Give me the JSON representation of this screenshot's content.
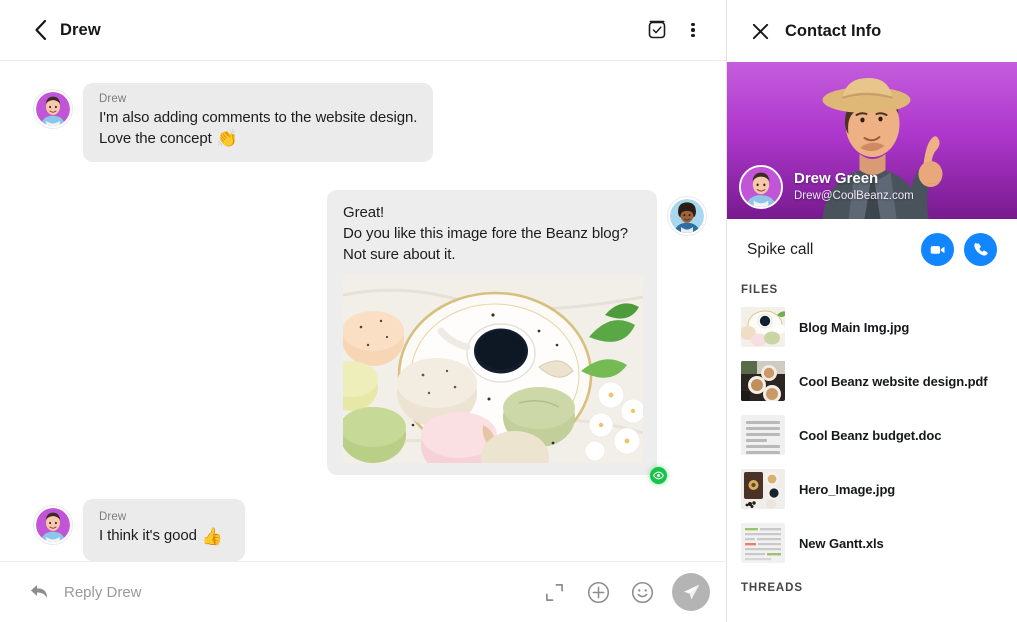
{
  "chat": {
    "header": {
      "title": "Drew",
      "back_icon": "back-chevron-icon",
      "task_icon": "checkbox-task-icon",
      "menu_icon": "more-vertical-icon"
    },
    "messages": [
      {
        "direction": "incoming",
        "sender": "Drew",
        "lines": [
          "I'm also adding comments to the website design.",
          "Love the concept"
        ],
        "emoji": "👏",
        "avatar_name": "drew-avatar"
      },
      {
        "direction": "outgoing",
        "sender": "",
        "lines": [
          "Great!",
          "Do you like this image fore the Beanz blog?",
          "Not sure about it."
        ],
        "emoji": "",
        "attachment": "coffee-macarons-photo",
        "status": "seen",
        "avatar_name": "me-avatar"
      },
      {
        "direction": "incoming",
        "sender": "Drew",
        "lines": [
          "I think it's good"
        ],
        "emoji": "👍",
        "avatar_name": "drew-avatar"
      }
    ],
    "composer": {
      "reply_icon": "reply-arrow-icon",
      "placeholder": "Reply Drew",
      "value": "",
      "expand_icon": "expand-icon",
      "attach_icon": "plus-circle-icon",
      "emoji_icon": "smiley-icon",
      "send_icon": "send-paper-plane-icon"
    }
  },
  "contact_info": {
    "header": {
      "close_icon": "close-x-icon",
      "title": "Contact Info"
    },
    "profile": {
      "name": "Drew Green",
      "email": "Drew@CoolBeanz.com",
      "avatar_name": "drew-profile-avatar",
      "banner_name": "man-pointing-up-photo"
    },
    "call": {
      "label": "Spike call",
      "video_icon": "video-camera-icon",
      "phone_icon": "phone-icon"
    },
    "files_label": "FILES",
    "files": [
      {
        "name": "Blog Main Img.jpg",
        "thumb": "coffee-macarons-thumb"
      },
      {
        "name": "Cool Beanz website design.pdf",
        "thumb": "latte-cups-thumb"
      },
      {
        "name": "Cool Beanz budget.doc",
        "thumb": "document-lines-thumb"
      },
      {
        "name": "Hero_Image.jpg",
        "thumb": "coffee-cup-thumb"
      },
      {
        "name": "New Gantt.xls",
        "thumb": "spreadsheet-thumb"
      }
    ],
    "threads_label": "THREADS"
  },
  "colors": {
    "call_blue": "#1186ff",
    "seen_green": "#16c44a",
    "bubble_gray": "#ebebeb",
    "hero_purple": "#b63fd3",
    "send_gray": "#b4b4b4"
  }
}
